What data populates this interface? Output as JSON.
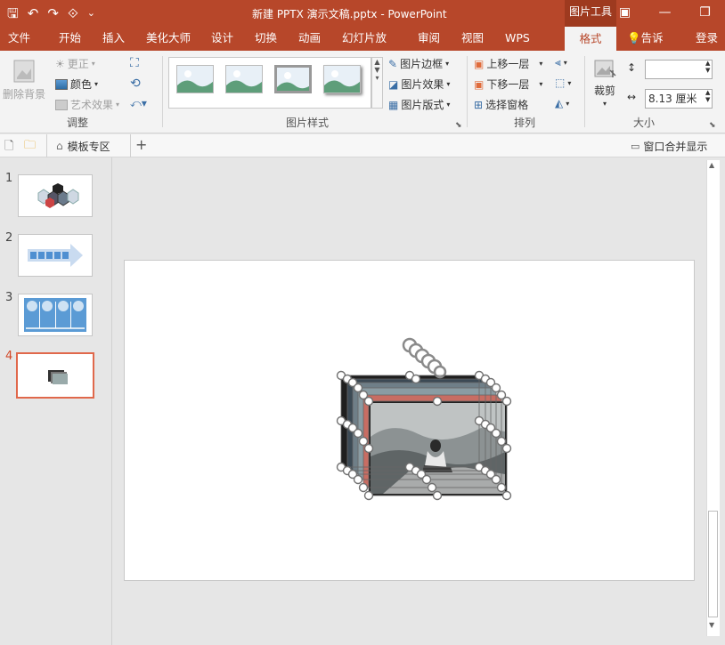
{
  "titlebar": {
    "title": "新建 PPTX 演示文稿.pptx - PowerPoint",
    "context_tab": "图片工具",
    "qat_save": "🖫",
    "qat_undo": "↶",
    "qat_redo": "↷",
    "qat_present": "⟐",
    "qat_more": "⌄",
    "window_ribbon_opt": "▣",
    "window_minimize": "—",
    "window_restore": "❐"
  },
  "tabs": [
    "文件",
    "开始",
    "插入",
    "美化大师",
    "设计",
    "切换",
    "动画",
    "幻灯片放映",
    "审阅",
    "视图",
    "WPS PDF",
    "格式"
  ],
  "active_tab": "格式",
  "tell_me": "告诉我...",
  "login": "登录",
  "ribbon": {
    "adjust": {
      "remove_bg": "删除背景",
      "correct": "更正",
      "color": "颜色",
      "art_effect": "艺术效果",
      "label": "调整"
    },
    "picture_styles": {
      "border": "图片边框",
      "effect": "图片效果",
      "layout": "图片版式",
      "label": "图片样式"
    },
    "arrange": {
      "bring_forward": "上移一层",
      "send_backward": "下移一层",
      "selection_pane": "选择窗格",
      "label": "排列"
    },
    "size": {
      "crop": "裁剪",
      "height_value": "",
      "width_value": "8.13 厘米",
      "label": "大小"
    }
  },
  "toolbar2": {
    "template_zone": "模板专区",
    "add": "+",
    "merge_window": "窗口合并显示"
  },
  "slides": [
    {
      "num": "1"
    },
    {
      "num": "2"
    },
    {
      "num": "3"
    },
    {
      "num": "4"
    }
  ],
  "active_slide": "4",
  "colors": {
    "accent": "#b7472a",
    "ribbon_bg": "#f3f3f3",
    "thumb_blue": "#4f8fd1"
  }
}
